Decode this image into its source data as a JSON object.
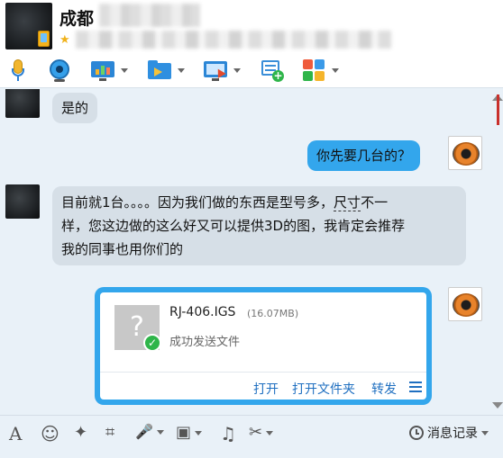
{
  "header": {
    "contact_name": "成都",
    "star": "★"
  },
  "toolbar": {
    "items": [
      {
        "name": "voice-call",
        "icon": "microphone-icon",
        "has_dropdown": false
      },
      {
        "name": "video-call",
        "icon": "webcam-icon",
        "has_dropdown": false
      },
      {
        "name": "share-screen",
        "icon": "screen-share-icon",
        "has_dropdown": true
      },
      {
        "name": "send-file",
        "icon": "folder-send-icon",
        "has_dropdown": true
      },
      {
        "name": "remote-desktop",
        "icon": "remote-desktop-icon",
        "has_dropdown": true
      },
      {
        "name": "create-discussion",
        "icon": "note-add-icon",
        "has_dropdown": false
      },
      {
        "name": "apps",
        "icon": "apps-grid-icon",
        "has_dropdown": true
      }
    ]
  },
  "messages": {
    "m1": "是的",
    "m2": "你先要几台的？",
    "m3_line1_a": "目前就1台。。。。因为我们做的东西是型号多，",
    "m3_line1_b": "尺寸",
    "m3_line1_c": "不一",
    "m3_line2": "样，您这边做的这么好又可以提供3D的图，我肯定会推荐",
    "m3_line3": "我的同事也用你们的"
  },
  "file_card": {
    "thumb_glyph": "?",
    "check_glyph": "✓",
    "filename": "RJ-406.IGS",
    "size": "(16.07MB)",
    "status": "成功发送文件",
    "actions": {
      "open": "打开",
      "open_folder": "打开文件夹",
      "forward": "转发"
    }
  },
  "bottom_toolbar": {
    "font_glyph": "A",
    "emoji_glyph": "☺",
    "shake_glyph": "✦",
    "screenshot_glyph": "⌗",
    "voice_glyph": "🎤",
    "image_glyph": "▣",
    "music_glyph": "♫",
    "scissors_glyph": "✂",
    "history_label": "消息记录"
  },
  "colors": {
    "incoming_bubble": "#d6dfe7",
    "outgoing_bubble": "#33a6ec",
    "link": "#1f6fc0",
    "background": "#e9f1f8"
  }
}
